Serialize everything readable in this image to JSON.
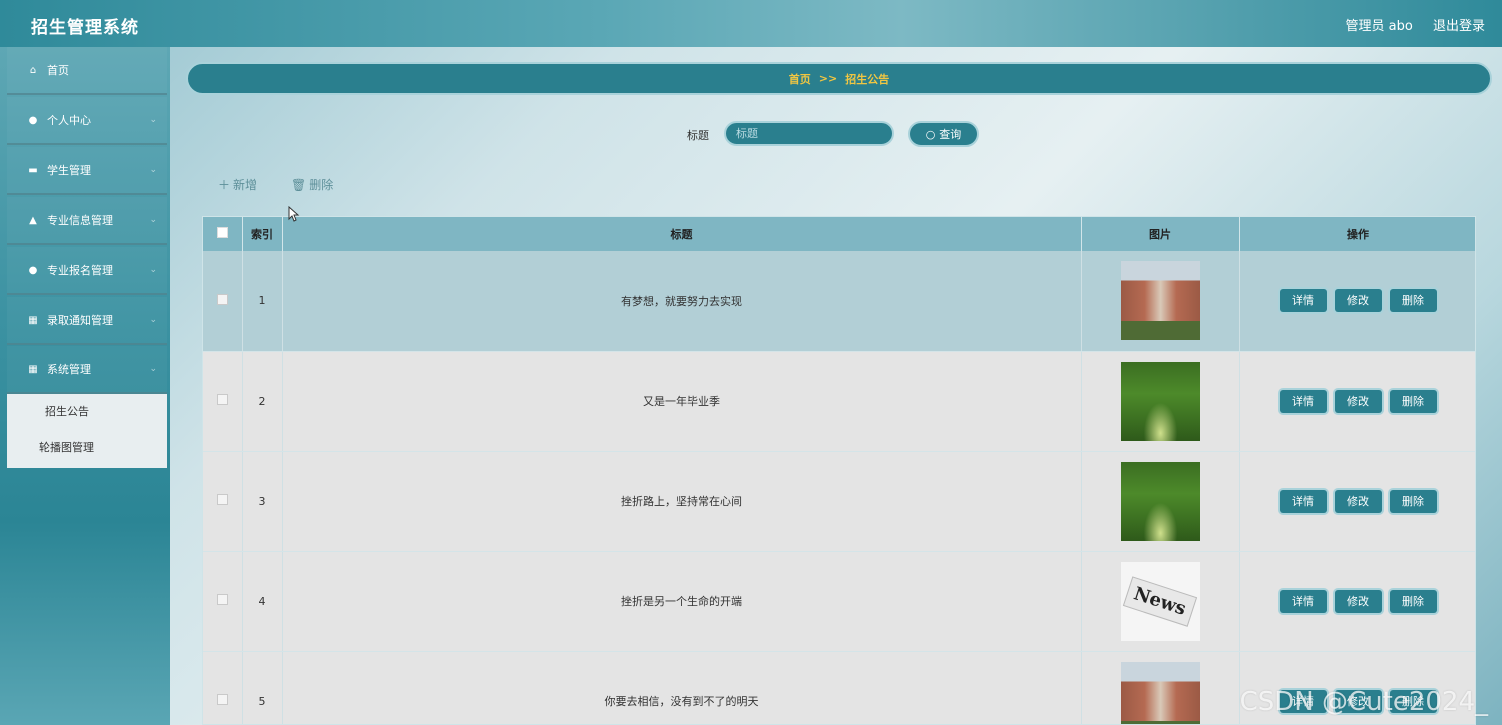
{
  "header": {
    "app_title": "招生管理系统",
    "user_label": "管理员 abo",
    "logout_label": "退出登录"
  },
  "sidebar": {
    "items": [
      {
        "label": "首页",
        "icon": "home-icon"
      },
      {
        "label": "个人中心",
        "icon": "user-icon"
      },
      {
        "label": "学生管理",
        "icon": "briefcase-icon"
      },
      {
        "label": "专业信息管理",
        "icon": "thumbs-up-icon"
      },
      {
        "label": "专业报名管理",
        "icon": "map-pin-icon"
      },
      {
        "label": "录取通知管理",
        "icon": "grid-icon"
      },
      {
        "label": "系统管理",
        "icon": "grid-icon"
      }
    ],
    "submenu": [
      {
        "label": "招生公告"
      },
      {
        "label": "轮播图管理"
      }
    ]
  },
  "breadcrumb": {
    "home": "首页",
    "separator": ">>",
    "current": "招生公告"
  },
  "search": {
    "label": "标题",
    "placeholder": "标题",
    "button_label": "查询"
  },
  "actions": {
    "add_label": "新增",
    "delete_label": "删除"
  },
  "table": {
    "columns": [
      "索引",
      "标题",
      "图片",
      "操作"
    ],
    "rows": [
      {
        "index": "1",
        "title": "有梦想，就要努力去实现",
        "image": "campus"
      },
      {
        "index": "2",
        "title": "又是一年毕业季",
        "image": "trees"
      },
      {
        "index": "3",
        "title": "挫折路上，坚持常在心间",
        "image": "trees"
      },
      {
        "index": "4",
        "title": "挫折是另一个生命的开端",
        "image": "news"
      },
      {
        "index": "5",
        "title": "你要去相信，没有到不了的明天",
        "image": "campus"
      }
    ],
    "row_buttons": {
      "detail": "详情",
      "edit": "修改",
      "delete": "删除"
    },
    "news_image_text": "News"
  },
  "watermark": "CSDN @Cute2024_",
  "colors": {
    "primary": "#2a7f8e",
    "breadcrumb_text": "#f0c642",
    "header_row": "#7fb6c3"
  }
}
